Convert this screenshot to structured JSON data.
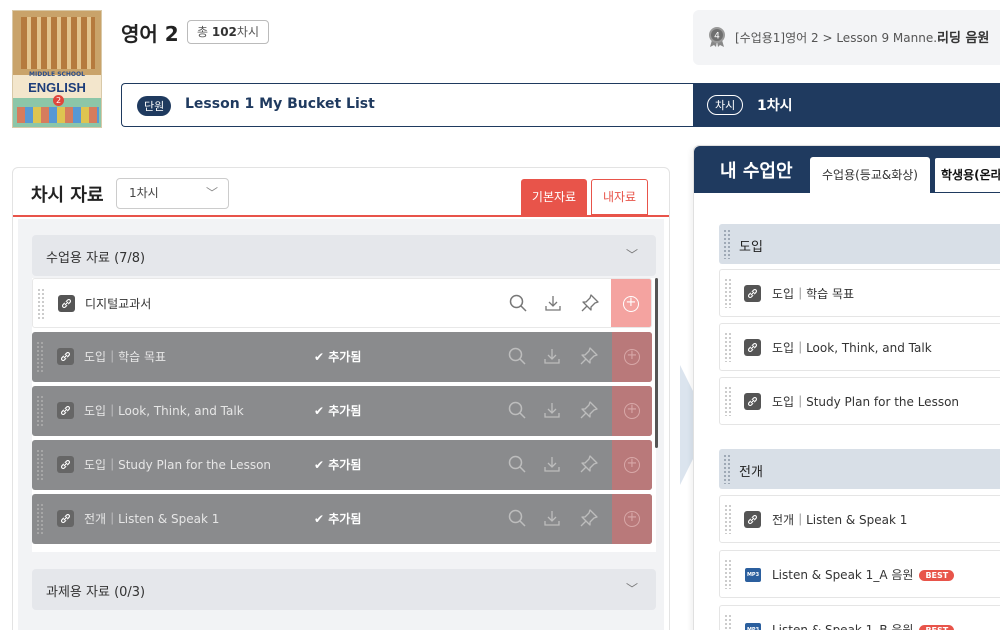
{
  "book": {
    "cover_top": "MIDDLE SCHOOL",
    "cover_main": "ENGLISH",
    "cover_num": "2"
  },
  "course": {
    "title": "영어 2",
    "total_prefix": "총 ",
    "total_count": "102",
    "total_suffix": "차시"
  },
  "recent": {
    "text": "[수업용1]영어 2 > Lesson 9 Manne...",
    "action": "리딩 음원",
    "medal_num": "4"
  },
  "unit_bar": {
    "pill": "단원",
    "text": "Lesson 1 My Bucket List"
  },
  "lesson_bar": {
    "pill": "차시",
    "text": "1차시"
  },
  "left_panel": {
    "title": "차시 자료",
    "select_value": "1차시",
    "tab_basic": "기본자료",
    "tab_mine": "내자료",
    "section1": "수업용 자료 (7/8)",
    "section2": "과제용 자료 (0/3)",
    "added_label": "✔ 추가됨",
    "rows": [
      {
        "title": "디지털교과서",
        "added": false
      },
      {
        "title": "도입｜학습 목표",
        "added": true
      },
      {
        "title": "도입｜Look, Think, and Talk",
        "added": true
      },
      {
        "title": "도입｜Study Plan for the Lesson",
        "added": true
      },
      {
        "title": "전개｜Listen & Speak 1",
        "added": true
      }
    ]
  },
  "right_panel": {
    "title": "내 수업안",
    "tab1": "수업용(등교&화상)",
    "tab2": "학생용(온라",
    "group1": "도입",
    "group2": "전개",
    "items": [
      "도입｜학습 목표",
      "도입｜Look, Think, and Talk",
      "도입｜Study Plan for the Lesson",
      "전개｜Listen & Speak 1"
    ],
    "mp3_items": [
      "Listen & Speak 1_A 음원",
      "Listen & Speak 1_B 음원"
    ],
    "mp3_label": "MP3",
    "best": "BEST"
  },
  "colors": {
    "navy": "#1f3a5f",
    "accent_red": "#e8544a",
    "added_gray": "#8a8b8d"
  },
  "icons": [
    "link-icon",
    "search-icon",
    "download-icon",
    "pin-icon",
    "add-circle-icon",
    "chevron-down-icon",
    "medal-icon",
    "mp3-icon"
  ]
}
